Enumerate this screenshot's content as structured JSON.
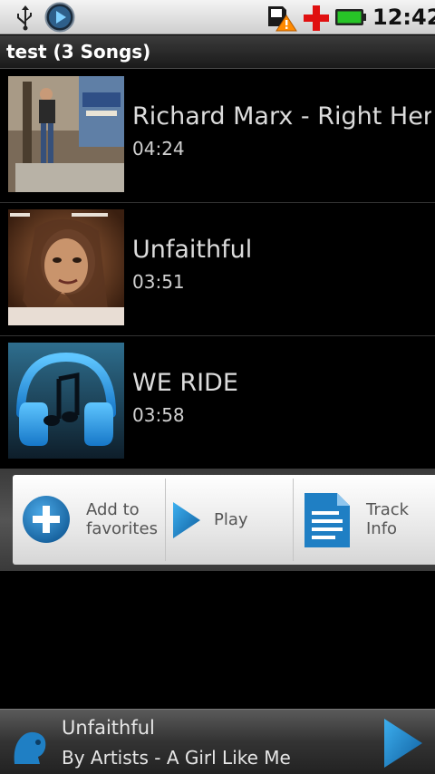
{
  "status_bar": {
    "time": "12:42",
    "icons": [
      "usb-icon",
      "music-playing-icon",
      "sd-card-warning-icon",
      "red-cross-icon",
      "battery-icon"
    ],
    "colors": {
      "battery": "#1fbf1f",
      "cross": "#e01010",
      "warning": "#ff8a00"
    }
  },
  "header": {
    "title": "test (3 Songs)"
  },
  "songs": [
    {
      "title": "Richard Marx - Right Here Waiting",
      "duration": "04:24",
      "cover_icon": "album-cover-richard-marx"
    },
    {
      "title": "Unfaithful",
      "duration": "03:51",
      "cover_icon": "album-cover-rihanna"
    },
    {
      "title": "WE RIDE",
      "duration": "03:58",
      "cover_icon": "headphones-icon"
    }
  ],
  "quick_actions": {
    "add_favorites": {
      "line1": "Add to",
      "line2": "favorites",
      "icon": "add-circle-icon"
    },
    "play": {
      "label": "Play",
      "icon": "play-icon"
    },
    "track_info": {
      "line1": "Track",
      "line2": "Info",
      "icon": "document-icon"
    },
    "accent": "#1f7fc4"
  },
  "now_playing": {
    "title": "Unfaithful",
    "subtitle": "By Artists - A Girl Like Me",
    "icons": [
      "artist-icon",
      "play-icon"
    ]
  }
}
